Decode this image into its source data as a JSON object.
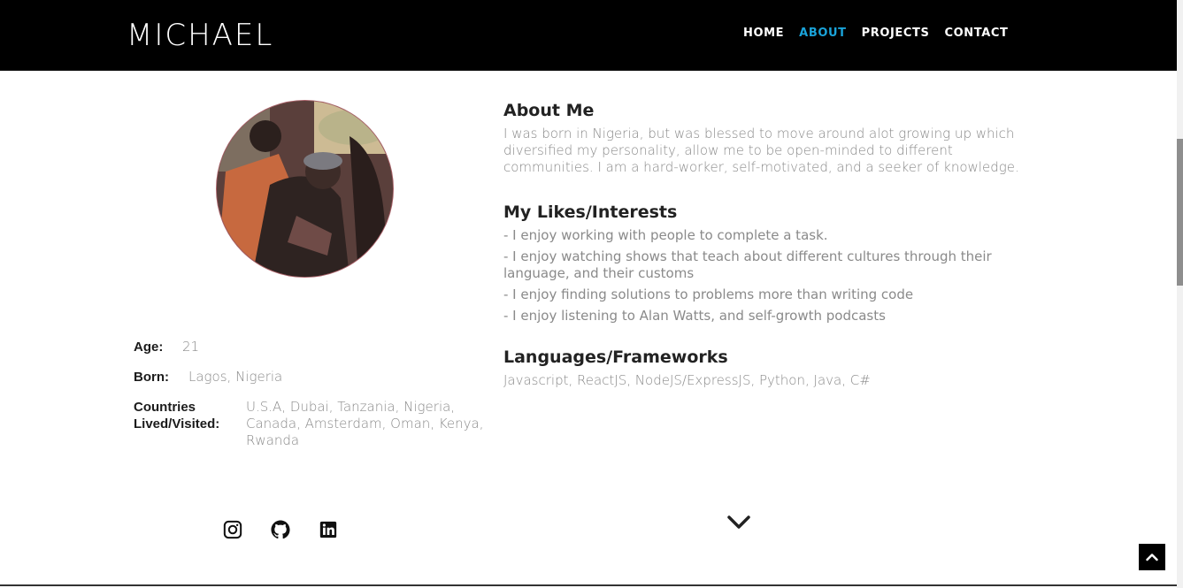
{
  "nav": {
    "brand": "MICHAEL",
    "items": [
      {
        "label": "HOME"
      },
      {
        "label": "ABOUT",
        "active": true
      },
      {
        "label": "PROJECTS"
      },
      {
        "label": "CONTACT"
      }
    ],
    "active_color": "#1aa3d9"
  },
  "profile": {
    "age_label": "Age:",
    "age_value": "21",
    "born_label": "Born:",
    "born_value": "Lagos, Nigeria",
    "countries_label": "Countries Lived/Visited:",
    "countries_value": "U.S.A, Dubai, Tanzania, Nigeria, Canada, Amsterdam, Oman, Kenya, Rwanda"
  },
  "about": {
    "title": "About Me",
    "text": "I was born in Nigeria, but was blessed to move around alot growing up which diversified my personality, allow me to be open-minded to different communities. I am a hard-worker, self-motivated, and a seeker of knowledge."
  },
  "likes": {
    "title": "My Likes/Interests",
    "items": [
      "- I enjoy working with people to complete a task.",
      "- I enjoy watching shows that teach about different cultures through their language, and their customs",
      "- I enjoy finding solutions to problems more than writing code",
      "- I enjoy listening to Alan Watts, and self-growth podcasts"
    ]
  },
  "languages": {
    "title": "Languages/Frameworks",
    "text": "Javascript, ReactJS, NodeJS/ExpressJS, Python, Java, C#"
  },
  "socials": [
    {
      "icon": "instagram-icon"
    },
    {
      "icon": "github-icon"
    },
    {
      "icon": "linkedin-icon"
    }
  ]
}
